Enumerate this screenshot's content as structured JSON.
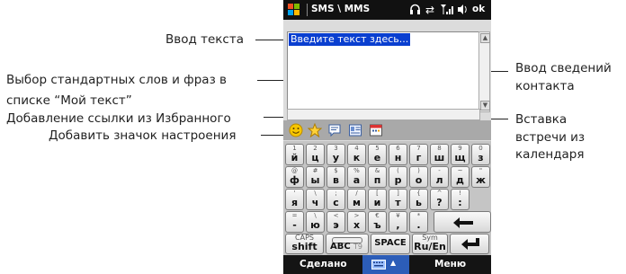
{
  "annotations": {
    "text_input": "Ввод текста",
    "standard_words_line1": "Выбор стандартных слов и фраз в",
    "standard_words_line2": "списке “Мой текст”",
    "favorites_link": "Добавление ссылки из Избранного",
    "mood_icon": "Добавить значок настроения",
    "contact_line1": "Ввод сведений",
    "contact_line2": "контакта",
    "calendar_line1": "Вставка",
    "calendar_line2": "встречи из",
    "calendar_line3": "календаря"
  },
  "titlebar": {
    "title": "SMS \\ MMS",
    "ok": "ok"
  },
  "textarea": {
    "placeholder": "Введите текст здесь..."
  },
  "keyboard": {
    "row1": [
      {
        "sub": "1",
        "main": "й"
      },
      {
        "sub": "2",
        "main": "ц"
      },
      {
        "sub": "3",
        "main": "у"
      },
      {
        "sub": "4",
        "main": "к"
      },
      {
        "sub": "5",
        "main": "е"
      },
      {
        "sub": "6",
        "main": "н"
      },
      {
        "sub": "7",
        "main": "г"
      },
      {
        "sub": "8",
        "main": "ш"
      },
      {
        "sub": "9",
        "main": "щ"
      },
      {
        "sub": "0",
        "main": "з"
      }
    ],
    "row2": [
      {
        "sub": "@",
        "main": "ф"
      },
      {
        "sub": "#",
        "main": "ы"
      },
      {
        "sub": "$",
        "main": "в"
      },
      {
        "sub": "%",
        "main": "а"
      },
      {
        "sub": "&",
        "main": "п"
      },
      {
        "sub": "(",
        "main": "р"
      },
      {
        "sub": ")",
        "main": "о"
      },
      {
        "sub": "-",
        "main": "л"
      },
      {
        "sub": "~",
        "main": "д"
      },
      {
        "sub": "\"",
        "main": "ж"
      }
    ],
    "row3": [
      {
        "sub": "'",
        "main": "я"
      },
      {
        "sub": "\\",
        "main": "ч"
      },
      {
        "sub": ";",
        "main": "с"
      },
      {
        "sub": "/",
        "main": "м"
      },
      {
        "sub": "[",
        "main": "и"
      },
      {
        "sub": "]",
        "main": "т"
      },
      {
        "sub": "{",
        "main": "ь"
      },
      {
        "sub": "^",
        "main": "?"
      },
      {
        "sub": "!",
        "main": ":"
      }
    ],
    "row4": [
      {
        "sub": "=",
        "main": "-"
      },
      {
        "sub": "\\",
        "main": "ю"
      },
      {
        "sub": "<",
        "main": "э"
      },
      {
        "sub": ">",
        "main": "х"
      },
      {
        "sub": "€",
        "main": "ъ"
      },
      {
        "sub": "¥",
        "main": ","
      },
      {
        "sub": "*",
        "main": "."
      }
    ],
    "caps_top": "CAPS",
    "caps_bottom": "shift",
    "abc": "ABC",
    "abc_sub": "T9",
    "space": "SPACE",
    "sym_top": "Sym",
    "sym_bottom": "Ru/En"
  },
  "softbar": {
    "left": "Сделано",
    "right": "Меню"
  },
  "colors": {
    "selection": "#0a3fd0",
    "titlebar": "#111111",
    "toolbar": "#a9a9a9"
  }
}
